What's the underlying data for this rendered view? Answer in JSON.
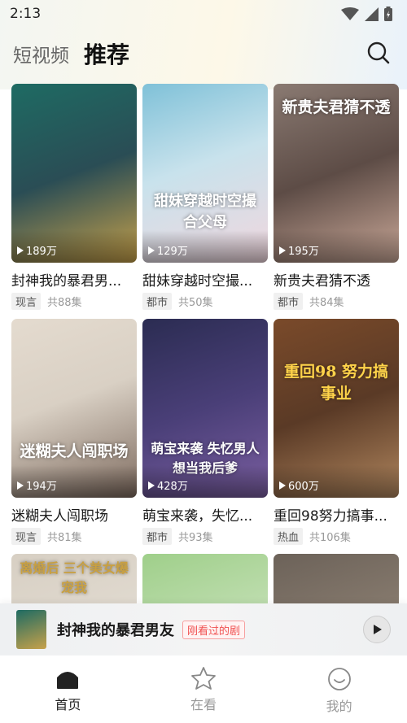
{
  "status": {
    "time": "2:13"
  },
  "header": {
    "tab_short_video": "短视频",
    "tab_recommend": "推荐"
  },
  "cards": [
    {
      "title": "封神我的暴君男...",
      "genre": "现言",
      "episodes": "共88集",
      "views": "189万",
      "poster_title": "",
      "colors": [
        "#1e6b63",
        "#c7a14a"
      ]
    },
    {
      "title": "甜妹穿越时空撮...",
      "genre": "都市",
      "episodes": "共50集",
      "views": "129万",
      "poster_title": "甜妹穿越时空撮合父母",
      "colors": [
        "#7fc1d8",
        "#f1d7de"
      ]
    },
    {
      "title": "新贵夫君猜不透",
      "genre": "都市",
      "episodes": "共84集",
      "views": "195万",
      "poster_title": "新贵夫君猜不透",
      "colors": [
        "#8a7a72",
        "#caa898"
      ]
    },
    {
      "title": "迷糊夫人闯职场",
      "genre": "现言",
      "episodes": "共81集",
      "views": "194万",
      "poster_title": "迷糊夫人闯职场",
      "colors": [
        "#d9d0c4",
        "#7d6a5e"
      ]
    },
    {
      "title": "萌宝来袭，失忆...",
      "genre": "都市",
      "episodes": "共93集",
      "views": "428万",
      "poster_title": "萌宝来袭 失忆男人想当我后爹",
      "colors": [
        "#2b2c52",
        "#7a5ea0"
      ]
    },
    {
      "title": "重回98努力搞事...",
      "genre": "热血",
      "episodes": "共106集",
      "views": "600万",
      "poster_title": "重回98 努力搞事业",
      "colors": [
        "#7a4a2a",
        "#b0865e"
      ]
    },
    {
      "title": "",
      "genre": "",
      "episodes": "",
      "views": "",
      "poster_title": "离婚后 三个美女爆宠我",
      "colors": [
        "#d7cfc3",
        "#ece7df"
      ]
    },
    {
      "title": "",
      "genre": "",
      "episodes": "",
      "views": "",
      "poster_title": "",
      "colors": [
        "#9fcf8a",
        "#e8f0e0"
      ]
    },
    {
      "title": "",
      "genre": "",
      "episodes": "",
      "views": "",
      "poster_title": "",
      "colors": [
        "#6c6259",
        "#a89988"
      ]
    }
  ],
  "now_playing": {
    "title": "封神我的暴君男友",
    "badge": "刚看过的剧"
  },
  "nav": {
    "home": "首页",
    "watching": "在看",
    "mine": "我的"
  },
  "colors": {
    "accent_red": "#f05050"
  }
}
